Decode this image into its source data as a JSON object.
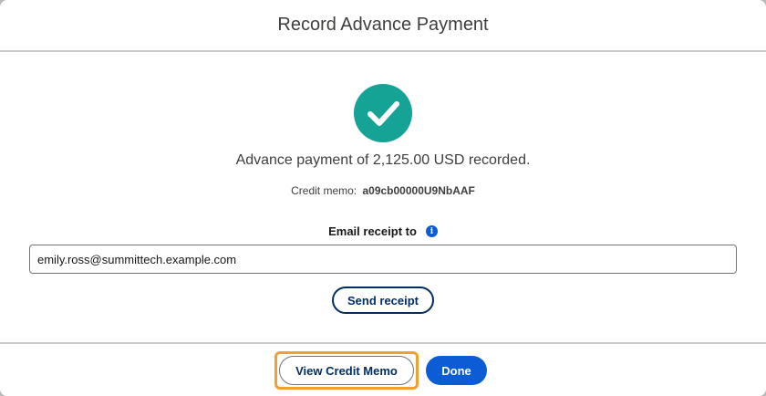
{
  "dialog": {
    "title": "Record Advance Payment"
  },
  "body": {
    "success_icon": "check-circle-icon",
    "message": "Advance payment of 2,125.00 USD recorded.",
    "memo_label": "Credit memo:",
    "memo_id": "a09cb00000U9NbAAF"
  },
  "email": {
    "label": "Email receipt to",
    "info_icon": "info-icon",
    "value": "emily.ross@summittech.example.com",
    "send_label": "Send receipt"
  },
  "footer": {
    "view_memo_label": "View Credit Memo",
    "done_label": "Done"
  },
  "colors": {
    "success": "#14a394",
    "brand": "#0b5cd5",
    "focus": "#f0a030",
    "dark_blue": "#032d60"
  }
}
